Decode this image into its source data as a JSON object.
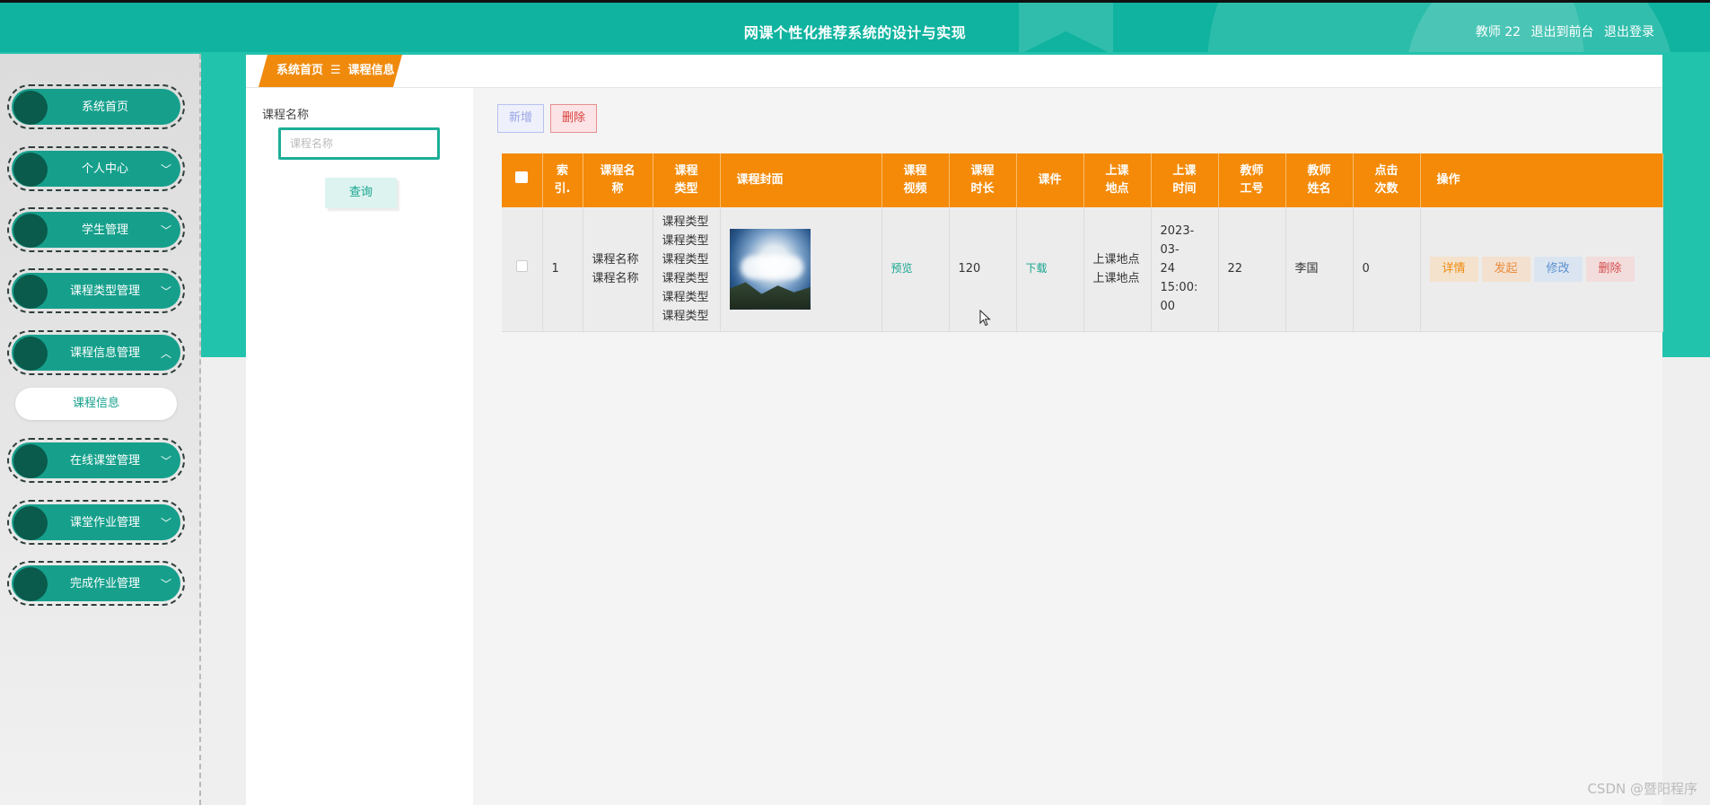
{
  "header": {
    "title": "网课个性化推荐系统的设计与实现",
    "user": "教师 22",
    "back_to_front": "退出到前台",
    "logout": "退出登录"
  },
  "sidebar": {
    "items": [
      {
        "label": "系统首页",
        "expandable": false
      },
      {
        "label": "个人中心",
        "expandable": true,
        "icon": "chevron-down-icon"
      },
      {
        "label": "学生管理",
        "expandable": true,
        "icon": "chevron-down-icon"
      },
      {
        "label": "课程类型管理",
        "expandable": true,
        "icon": "chevron-down-icon"
      },
      {
        "label": "课程信息管理",
        "expandable": true,
        "icon": "chevron-up-icon"
      },
      {
        "label": "在线课堂管理",
        "expandable": true,
        "icon": "chevron-down-icon"
      },
      {
        "label": "课堂作业管理",
        "expandable": true,
        "icon": "chevron-down-icon"
      },
      {
        "label": "完成作业管理",
        "expandable": true,
        "icon": "chevron-down-icon"
      }
    ],
    "submenu": {
      "label": "课程信息"
    }
  },
  "breadcrumb": {
    "home": "系统首页",
    "sep": "☰",
    "current": "课程信息"
  },
  "search": {
    "label": "课程名称",
    "placeholder": "课程名称",
    "query_button": "查询"
  },
  "toolbar": {
    "add_label": "新增",
    "delete_label": "删除"
  },
  "table": {
    "headers": {
      "index": "索\n引.",
      "course_name": "课程名\n称",
      "course_type": "课程\n类型",
      "cover": "课程封面",
      "video": "课程\n视频",
      "duration": "课程\n时长",
      "courseware": "课件",
      "location": "上课\n地点",
      "time": "上课\n时间",
      "teacher_id": "教师\n工号",
      "teacher_name": "教师\n姓名",
      "clicks": "点击\n次数",
      "actions": "操作"
    },
    "rows": [
      {
        "index": "1",
        "course_name": "课程名称\n课程名称",
        "course_type": "课程类型\n课程类型\n课程类型\n课程类型\n课程类型\n课程类型",
        "video": "预览",
        "duration": "120",
        "courseware": "下载",
        "location": "上课地点\n上课地点",
        "time": "2023-03-\n24 15:00:\n00",
        "teacher_id": "22",
        "teacher_name": "李国",
        "clicks": "0",
        "actions": {
          "detail": "详情",
          "start": "发起",
          "edit": "修改",
          "delete": "删除"
        }
      }
    ]
  },
  "watermark": "CSDN @暨阳程序"
}
